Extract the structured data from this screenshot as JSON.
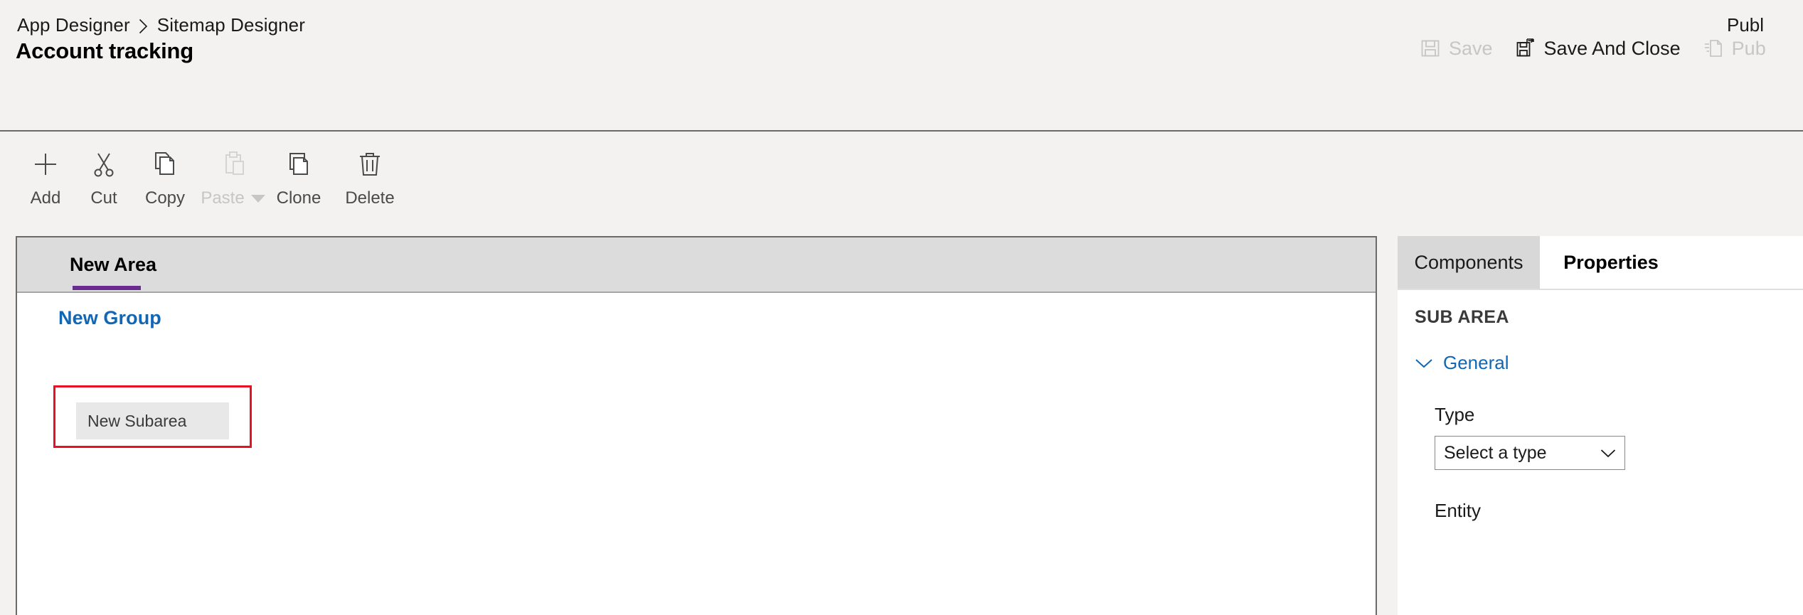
{
  "header": {
    "breadcrumb": [
      {
        "label": "App Designer"
      },
      {
        "label": "Sitemap Designer"
      }
    ],
    "breadcrumb_separator_icon": "chevron-right-icon",
    "title": "Account tracking",
    "publish_status": "Publ",
    "commands": [
      {
        "id": "save",
        "label": "Save",
        "icon": "save-floppy-icon",
        "disabled": true
      },
      {
        "id": "save-and-close",
        "label": "Save And Close",
        "icon": "save-and-close-icon",
        "disabled": false
      },
      {
        "id": "publish",
        "label": "Pub",
        "icon": "publish-page-icon",
        "disabled": true
      }
    ]
  },
  "toolbar": {
    "buttons": [
      {
        "id": "add",
        "label": "Add",
        "icon": "plus-icon",
        "disabled": false,
        "has_caret": false
      },
      {
        "id": "cut",
        "label": "Cut",
        "icon": "scissors-icon",
        "disabled": false,
        "has_caret": false
      },
      {
        "id": "copy",
        "label": "Copy",
        "icon": "copy-icon",
        "disabled": false,
        "has_caret": false
      },
      {
        "id": "paste",
        "label": "Paste",
        "icon": "clipboard-icon",
        "disabled": true,
        "has_caret": true
      },
      {
        "id": "clone",
        "label": "Clone",
        "icon": "clone-icon",
        "disabled": false,
        "has_caret": false
      },
      {
        "id": "delete",
        "label": "Delete",
        "icon": "trash-icon",
        "disabled": false,
        "has_caret": false
      }
    ]
  },
  "canvas": {
    "area_tab": {
      "label": "New Area",
      "selected": true
    },
    "group": {
      "label": "New Group"
    },
    "subarea": {
      "label": "New Subarea",
      "selected": true
    }
  },
  "panel": {
    "tabs": [
      {
        "id": "components",
        "label": "Components",
        "active": false
      },
      {
        "id": "properties",
        "label": "Properties",
        "active": true
      }
    ],
    "heading": "SUB AREA",
    "section": {
      "label": "General",
      "expanded": true,
      "icon": "chevron-down-icon"
    },
    "fields": [
      {
        "id": "type",
        "label": "Type",
        "value": "Select a type",
        "control": "dropdown"
      },
      {
        "id": "entity",
        "label": "Entity"
      }
    ]
  },
  "colors": {
    "accent_purple": "#6b2c91",
    "link_blue": "#1267b5",
    "selection_red": "#e81123",
    "panel_tab_inactive": "#d8d8d8",
    "chip_grey": "#e8e8e8",
    "app_bg": "#f3f2f1"
  }
}
